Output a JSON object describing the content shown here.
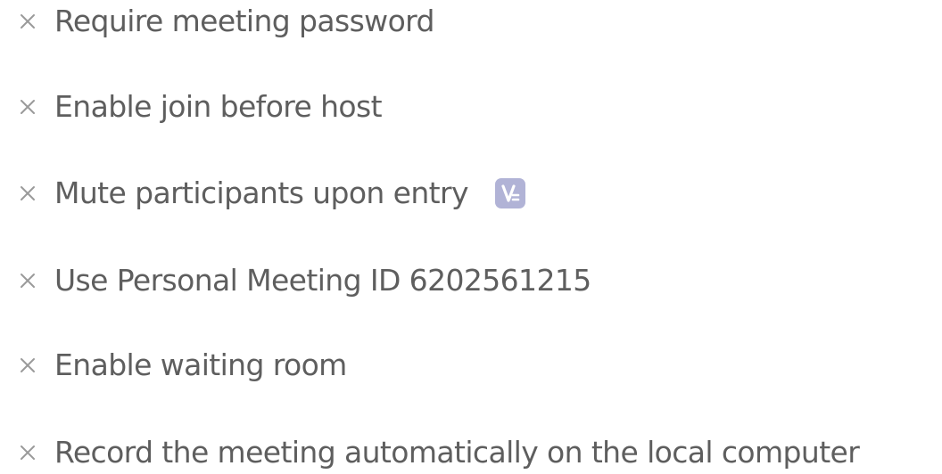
{
  "colors": {
    "label": "#5e5e5e",
    "x_icon": "#9a9a9a",
    "badge_bg": "#b1b3d6",
    "badge_fg": "#ffffff"
  },
  "meeting_options": {
    "items": [
      {
        "label": "Require meeting password",
        "icon": "x-icon",
        "checked": false
      },
      {
        "label": "Enable join before host",
        "icon": "x-icon",
        "checked": false
      },
      {
        "label": "Mute participants upon entry",
        "icon": "x-icon",
        "checked": false,
        "badge_icon": "pro-badge-icon"
      },
      {
        "label": "Use Personal Meeting ID 6202561215",
        "icon": "x-icon",
        "checked": false
      },
      {
        "label": "Enable waiting room",
        "icon": "x-icon",
        "checked": false
      },
      {
        "label": "Record the meeting automatically on the local computer",
        "icon": "x-icon",
        "checked": false
      }
    ]
  }
}
